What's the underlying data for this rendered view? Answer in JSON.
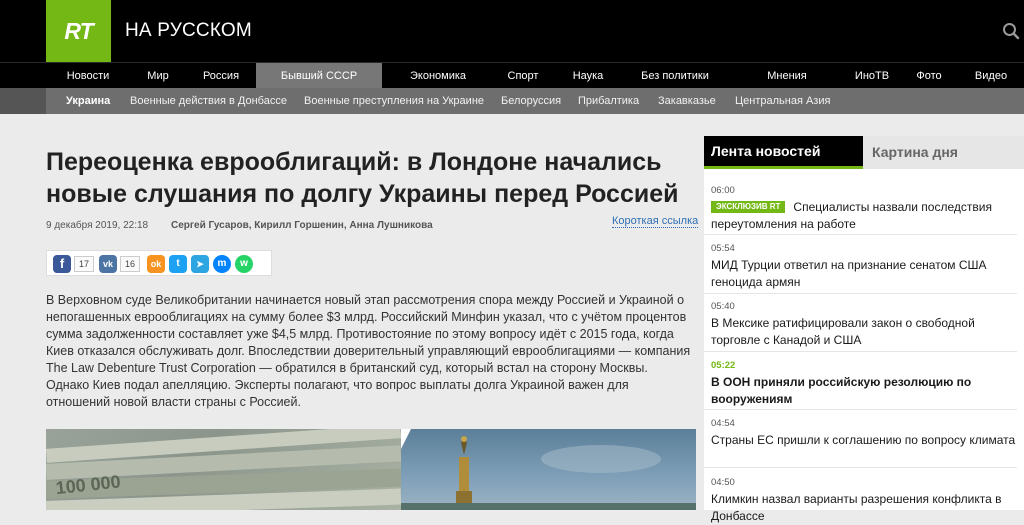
{
  "header": {
    "logo": "RT",
    "site_name": "НА РУССКОМ",
    "search_icon": "search-icon"
  },
  "nav_main": {
    "items": [
      {
        "label": "Новости"
      },
      {
        "label": "Мир"
      },
      {
        "label": "Россия"
      },
      {
        "label": "Бывший СССР",
        "active": true
      },
      {
        "label": "Экономика"
      },
      {
        "label": "Спорт"
      },
      {
        "label": "Наука"
      },
      {
        "label": "Без политики"
      },
      {
        "label": "Мнения"
      },
      {
        "label": "ИноТВ"
      },
      {
        "label": "Фото"
      },
      {
        "label": "Видео"
      }
    ]
  },
  "nav_sub": {
    "items": [
      {
        "label": "Украина",
        "active": true
      },
      {
        "label": "Военные действия в Донбассе"
      },
      {
        "label": "Военные преступления на Украине"
      },
      {
        "label": "Белоруссия"
      },
      {
        "label": "Прибалтика"
      },
      {
        "label": "Закавказье"
      },
      {
        "label": "Центральная Азия"
      }
    ]
  },
  "article": {
    "title": "Переоценка еврооблигаций: в Лондоне начались новые слушания по долгу Украины перед Россией",
    "date": "9 декабря 2019, 22:18",
    "authors": "Сергей Гусаров, Кирилл Горшенин, Анна Лушникова",
    "short_link": "Короткая ссылка",
    "body": "В Верховном суде Великобритании начинается новый этап рассмотрения спора между Россией и Украиной о непогашенных еврооблигациях на сумму более $3 млрд. Российский Минфин указал, что с учётом процентов сумма задолженности составляет уже $4,5 млрд. Противостояние по этому вопросу идёт с 2015 года, когда Киев отказался обслуживать долг. Впоследствии доверительный управляющий еврооблигациями — компания The Law Debenture Trust Corporation — обратился в британский суд, который встал на сторону Москвы. Однако Киев подал апелляцию. Эксперты полагают, что вопрос выплаты долга Украиной важен для отношений новой власти страны с Россией.",
    "share": {
      "facebook_count": "17",
      "vk_count": "16",
      "buttons": [
        {
          "name": "facebook",
          "color": "#3b5998",
          "glyph": "f"
        },
        {
          "name": "vk",
          "color": "#4c75a3",
          "glyph": "vk"
        },
        {
          "name": "odnoklassniki",
          "color": "#f7931e",
          "glyph": "ok"
        },
        {
          "name": "twitter",
          "color": "#1da1f2",
          "glyph": "t"
        },
        {
          "name": "telegram",
          "color": "#2ca5e0",
          "glyph": "➤"
        },
        {
          "name": "messenger",
          "color": "#0084ff",
          "glyph": "m"
        },
        {
          "name": "whatsapp",
          "color": "#25d366",
          "glyph": "w"
        }
      ]
    },
    "photo_banknote_text": "100 000"
  },
  "sidebar": {
    "tab_active": "Лента новостей",
    "tab_inactive": "Картина дня",
    "news": [
      {
        "time": "06:00",
        "badge": "ЭКСКЛЮЗИВ RT",
        "title": "Специалисты назвали последствия переутомления на работе"
      },
      {
        "time": "05:54",
        "title": "МИД Турции ответил на признание сенатом США геноцида армян"
      },
      {
        "time": "05:40",
        "title": "В Мексике ратифицировали закон о свободной торговле с Канадой и США"
      },
      {
        "time": "05:22",
        "title": "В ООН приняли российскую резолюцию по вооружениям",
        "highlight": true
      },
      {
        "time": "04:54",
        "title": "Страны ЕС пришли к соглашению по вопросу климата"
      },
      {
        "time": "04:50",
        "title": "Климкин назвал варианты разрешения конфликта в Донбассе"
      }
    ]
  },
  "colors": {
    "brand_green": "#74b816",
    "link_blue": "#2f6fb5"
  }
}
